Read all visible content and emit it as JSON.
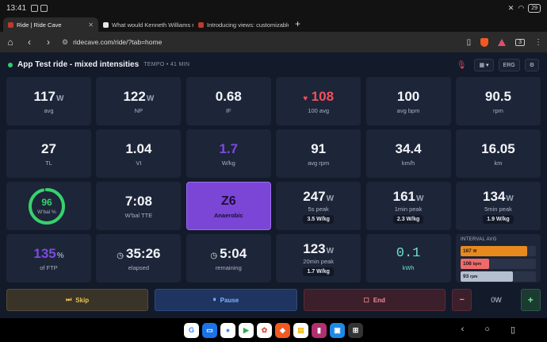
{
  "status_bar": {
    "time": "13:41",
    "battery": "29"
  },
  "tabs": [
    {
      "title": "Ride | Ride Cave",
      "active": true
    },
    {
      "title": "What would Kenneth Williams m",
      "active": false
    },
    {
      "title": "Introducing views: customizable",
      "active": false
    }
  ],
  "browser": {
    "url": "ridecave.com/ride/?tab=home",
    "tab_count": "3"
  },
  "ride": {
    "title": "App Test ride - mixed intensities",
    "subtitle": "TEMPO • 41 MIN",
    "erg_label": "ERG"
  },
  "tiles": {
    "avg_power": {
      "value": "117",
      "unit": "W",
      "label": "avg"
    },
    "np": {
      "value": "122",
      "unit": "W",
      "label": "NP"
    },
    "if": {
      "value": "0.68",
      "label": "IF"
    },
    "hr": {
      "value": "108",
      "label": "100 avg"
    },
    "avg_bpm": {
      "value": "100",
      "label": "avg bpm"
    },
    "rpm": {
      "value": "90.5",
      "label": "rpm"
    },
    "tl": {
      "value": "27",
      "label": "TL"
    },
    "vi": {
      "value": "1.04",
      "label": "VI"
    },
    "wkg": {
      "value": "1.7",
      "label": "W/kg"
    },
    "avg_rpm": {
      "value": "91",
      "label": "avg rpm"
    },
    "kmh": {
      "value": "34.4",
      "label": "km/h"
    },
    "km": {
      "value": "16.05",
      "label": "km"
    },
    "wbal": {
      "value": "96",
      "label": "W'bal %",
      "fraction": 0.96
    },
    "wbal_tte": {
      "value": "7:08",
      "label": "W'bal TTE"
    },
    "zone": {
      "value": "Z6",
      "label": "Anaerobic"
    },
    "peak_5s": {
      "value": "247",
      "unit": "W",
      "label": "5s peak",
      "badge": "3.5 W/kg"
    },
    "peak_1min": {
      "value": "161",
      "unit": "W",
      "label": "1min peak",
      "badge": "2.3 W/kg"
    },
    "peak_5min": {
      "value": "134",
      "unit": "W",
      "label": "5min peak",
      "badge": "1.9 W/kg"
    },
    "ftp_pct": {
      "value": "135",
      "unit": "%",
      "label": "of FTP"
    },
    "elapsed": {
      "value": "35:26",
      "label": "elapsed"
    },
    "remaining": {
      "value": "5:04",
      "label": "remaining"
    },
    "peak_20min": {
      "value": "123",
      "unit": "W",
      "label": "20min peak",
      "badge": "1.7 W/kg"
    },
    "kwh": {
      "value": "0.1",
      "label": "kWh"
    },
    "interval_avg": {
      "title": "INTERVAL AVG",
      "bars": [
        {
          "label": "167",
          "unit": "W",
          "level": 0.88,
          "color": "#e8891e"
        },
        {
          "label": "108",
          "unit": "bpm",
          "level": 0.38,
          "color": "#f06a6a"
        },
        {
          "label": "93",
          "unit": "rpm",
          "level": 0.7,
          "color": "#b4bfcf"
        }
      ]
    }
  },
  "controls": {
    "skip": "Skip",
    "pause": "Pause",
    "end": "End",
    "minus": "−",
    "offset": "0W",
    "plus": "+"
  }
}
